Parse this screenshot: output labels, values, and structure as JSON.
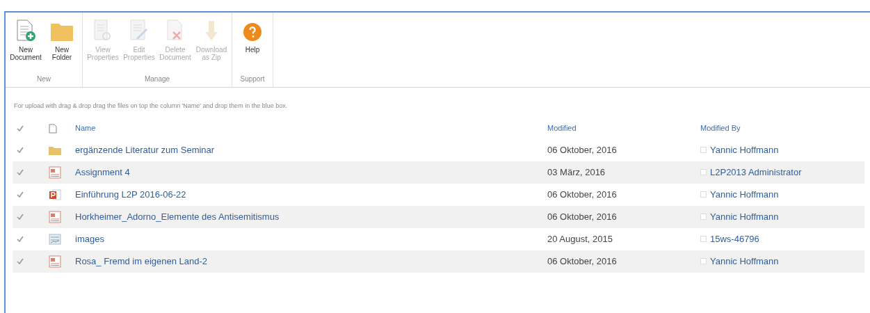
{
  "ribbon": {
    "groups": [
      {
        "label": "New",
        "buttons": [
          {
            "label": "New Document",
            "kind": "new-document",
            "disabled": false
          },
          {
            "label": "New Folder",
            "kind": "new-folder",
            "disabled": false
          }
        ]
      },
      {
        "label": "Manage",
        "buttons": [
          {
            "label": "View Properties",
            "kind": "view-properties",
            "disabled": true
          },
          {
            "label": "Edit Properties",
            "kind": "edit-properties",
            "disabled": true
          },
          {
            "label": "Delete Document",
            "kind": "delete",
            "disabled": true
          },
          {
            "label": "Download as Zip",
            "kind": "download",
            "disabled": true
          }
        ]
      },
      {
        "label": "Support",
        "buttons": [
          {
            "label": "Help",
            "kind": "help",
            "disabled": false
          }
        ]
      }
    ]
  },
  "notice": "For upload with drag & drop drag the files on top the column 'Name' and drop them in the blue box.",
  "table": {
    "columns": [
      "Name",
      "Modified",
      "Modified By"
    ],
    "rows": [
      {
        "kind": "folder",
        "name": "ergänzende Literatur zum Seminar",
        "modified": "06 Oktober, 2016",
        "modified_by": "Yannic Hoffmann"
      },
      {
        "kind": "pdf",
        "name": "Assignment 4",
        "modified": "03 März, 2016",
        "modified_by": "L2P2013 Administrator"
      },
      {
        "kind": "ppt",
        "name": "Einführung L2P 2016-06-22",
        "modified": "06 Oktober, 2016",
        "modified_by": "Yannic Hoffmann"
      },
      {
        "kind": "pdf",
        "name": "Horkheimer_Adorno_Elemente des Antisemitismus",
        "modified": "06 Oktober, 2016",
        "modified_by": "Yannic Hoffmann"
      },
      {
        "kind": "image",
        "name": "images",
        "modified": "20 August, 2015",
        "modified_by": "15ws-46796"
      },
      {
        "kind": "pdf",
        "name": "Rosa_ Fremd im eigenen Land-2",
        "modified": "06 Oktober, 2016",
        "modified_by": "Yannic Hoffmann"
      }
    ]
  }
}
